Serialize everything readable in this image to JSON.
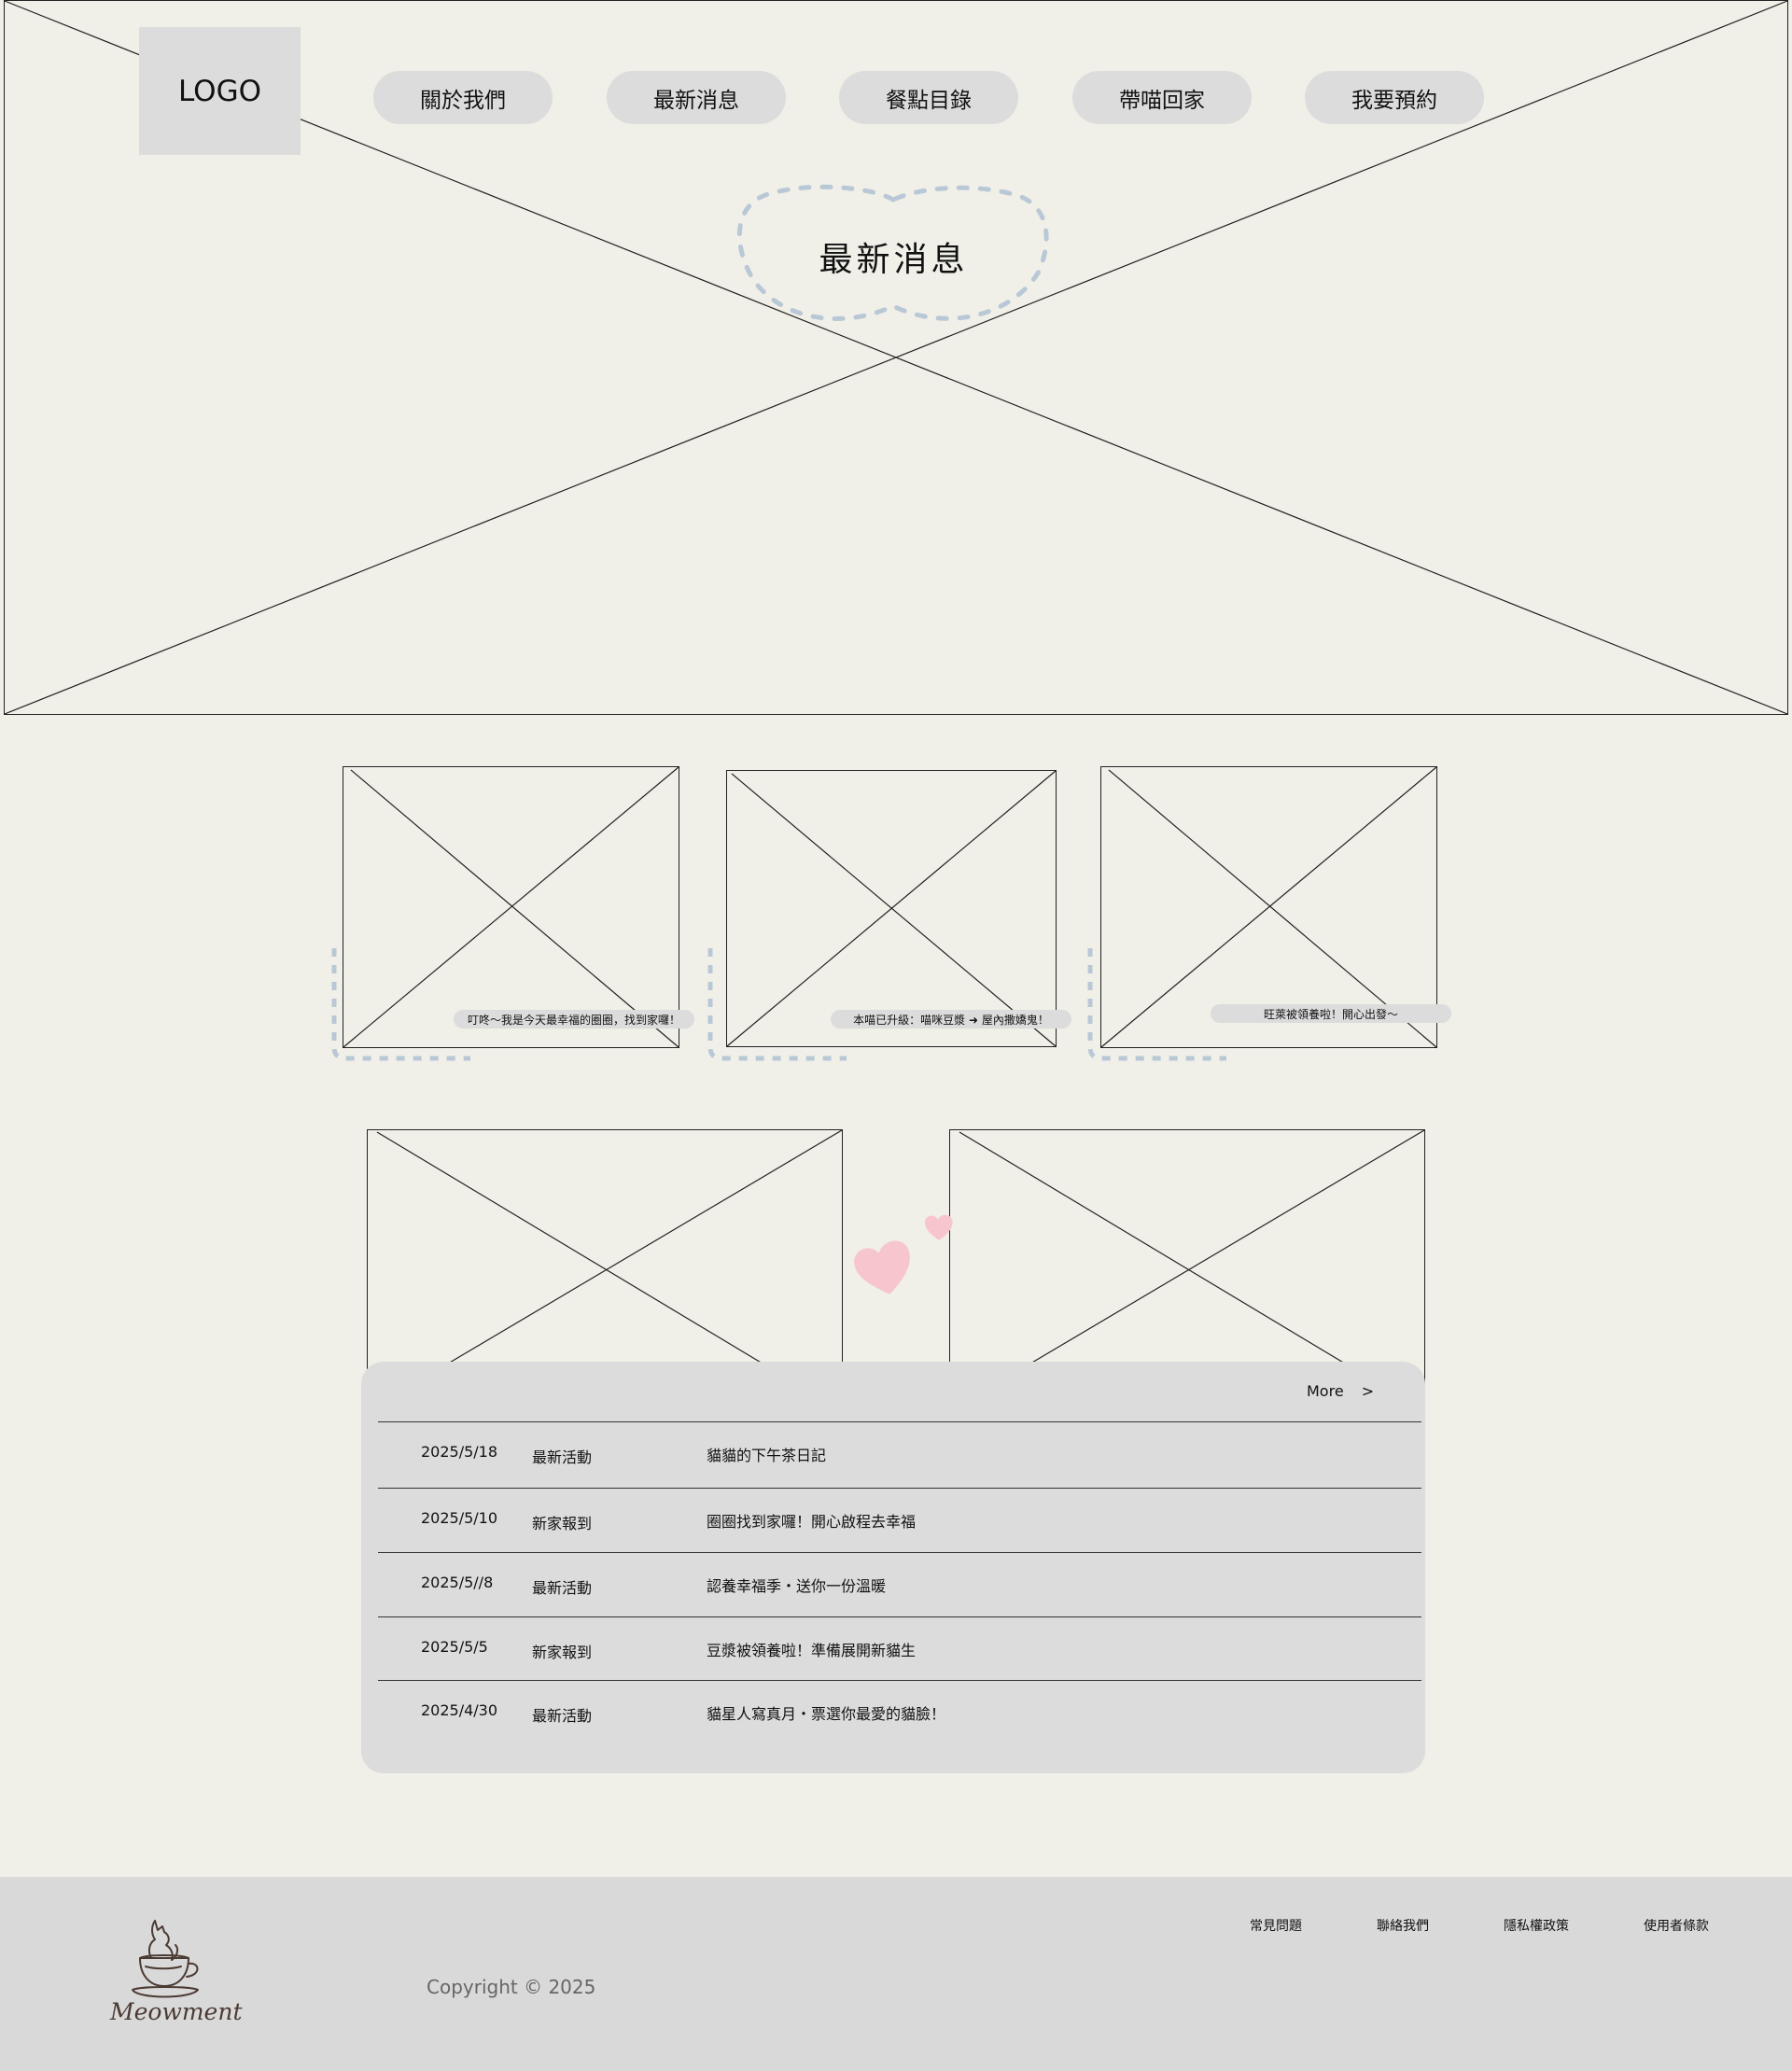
{
  "header": {
    "logo_text": "LOGO",
    "nav": [
      {
        "label": "關於我們"
      },
      {
        "label": "最新消息"
      },
      {
        "label": "餐點目錄"
      },
      {
        "label": "帶喵回家"
      },
      {
        "label": "我要預約"
      }
    ],
    "hero_title": "最新消息"
  },
  "cards": [
    {
      "caption": "叮咚～我是今天最幸福的圈圈，找到家囉！"
    },
    {
      "caption": "本喵已升級：喵咪豆漿 ➜ 屋內撒嬌鬼！"
    },
    {
      "caption": "旺萊被領養啦！開心出發～"
    }
  ],
  "news": {
    "more_label": "More >",
    "items": [
      {
        "date": "2025/5/18",
        "category": "最新活動",
        "title": "貓貓的下午茶日記"
      },
      {
        "date": "2025/5/10",
        "category": "新家報到",
        "title": "圈圈找到家囉！開心啟程去幸福"
      },
      {
        "date": "2025/5//8",
        "category": "最新活動",
        "title": "認養幸福季・送你一份溫暖"
      },
      {
        "date": "2025/5/5",
        "category": "新家報到",
        "title": "豆漿被領養啦！準備展開新貓生"
      },
      {
        "date": "2025/4/30",
        "category": "最新活動",
        "title": "貓星人寫真月・票選你最愛的貓臉！"
      }
    ]
  },
  "footer": {
    "brand": "Meowment",
    "copyright": "Copyright © 2025",
    "links": [
      {
        "label": "常見問題"
      },
      {
        "label": "聯絡我們"
      },
      {
        "label": "隱私權政策"
      },
      {
        "label": "使用者條款"
      }
    ]
  },
  "colors": {
    "page_bg": "#f0efe8",
    "pill_bg": "#dcdcdc",
    "dash_blue": "#b9c8d6",
    "heart_pink": "#f7c6cc",
    "footer_bg": "#d9d9d9",
    "brand_brown": "#4a3a32"
  }
}
